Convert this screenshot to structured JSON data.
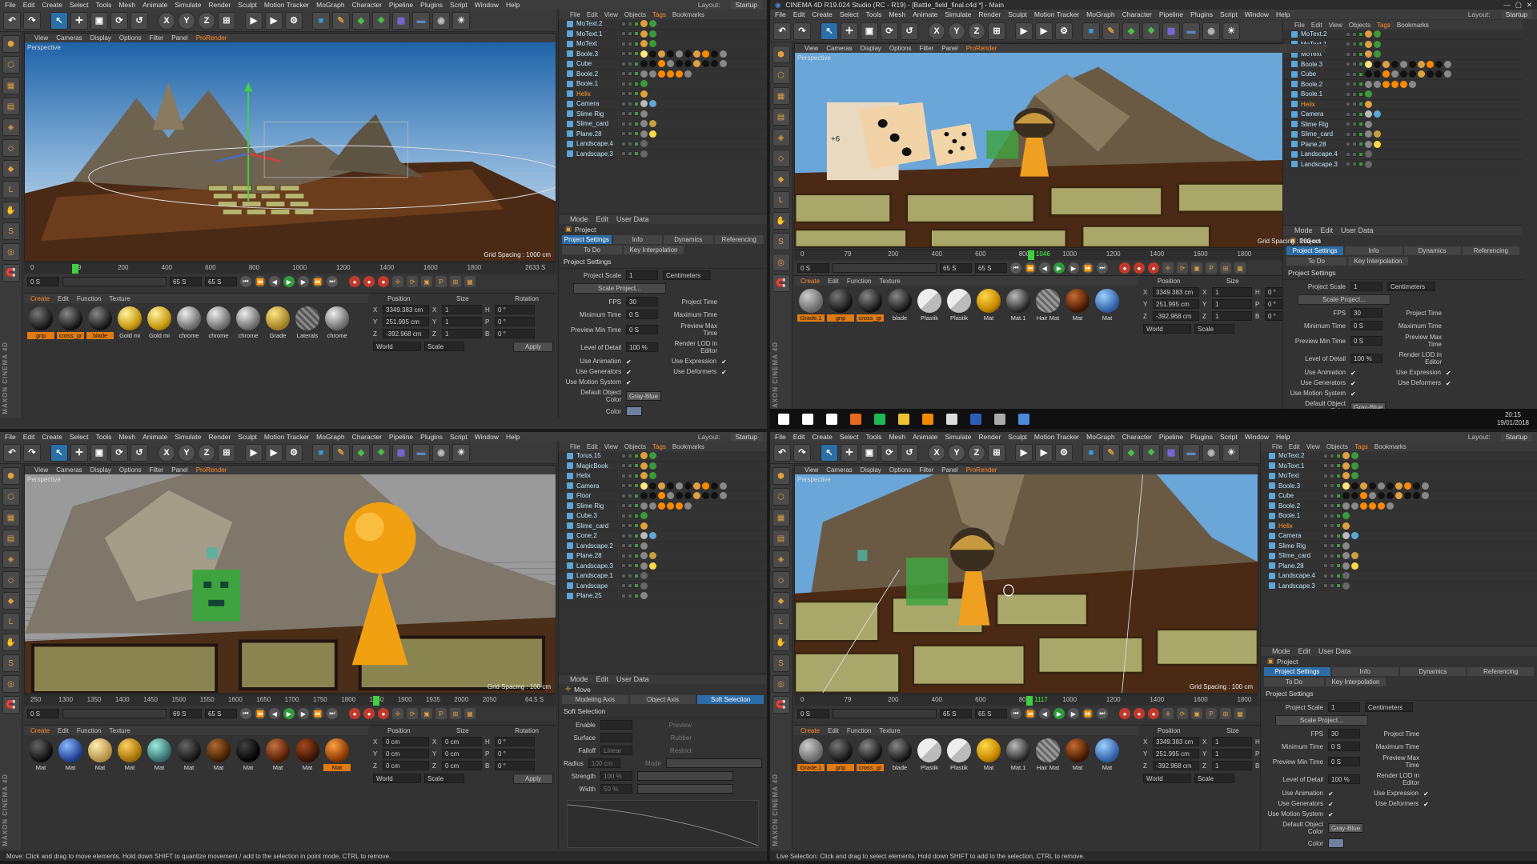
{
  "menu": [
    "File",
    "Edit",
    "Create",
    "Select",
    "Tools",
    "Mesh",
    "Animate",
    "Simulate",
    "Render",
    "Sculpt",
    "Motion Tracker",
    "MoGraph",
    "Character",
    "Pipeline",
    "Plugins",
    "Script",
    "Window",
    "Help"
  ],
  "layout_label": "Layout:",
  "layout_value": "Startup",
  "window_title": "CINEMA 4D R19.024 Studio (RC - R19) - [Battle_field_final.c4d *] - Main",
  "viewport_menu": [
    "View",
    "Cameras",
    "Display",
    "Options",
    "Filter",
    "Panel",
    "ProRender"
  ],
  "viewport_label": "Perspective",
  "grid_q1": "Grid Spacing : 1000 cm",
  "grid_other": "Grid Spacing : 100 cm",
  "obj_menu": [
    "File",
    "Edit",
    "View",
    "Objects",
    "Tags",
    "Bookmarks"
  ],
  "objects_a": [
    "MoText.2",
    "MoText.1",
    "MoText",
    "Boole.3",
    "Cube",
    "Boole.2",
    "Boole.1",
    "Helix",
    "Camera",
    "Slime Rig",
    "Slime_card",
    "Plane.28",
    "Landscape.4",
    "Landscape.3"
  ],
  "objects_b": [
    "Torus.15",
    "MagicBook",
    "Helix",
    "Camera",
    "Floor",
    "Slime Rig",
    "Cube.3",
    "Slime_card",
    "Cone.2",
    "Landscape.2",
    "Plane.28",
    "Landscape.3",
    "Landscape.1",
    "Landscape",
    "Plane.25"
  ],
  "attr_menu": [
    "Mode",
    "Edit",
    "User Data"
  ],
  "attr_title": "Project",
  "attr_tabs": [
    "Project Settings",
    "Info",
    "Dynamics",
    "Referencing"
  ],
  "attr_tabs2": [
    "To Do",
    "Key Interpolation"
  ],
  "section": "Project Settings",
  "project_scale": "Project Scale",
  "scale_val": "1",
  "scale_unit": "Centimeters",
  "scale_btn": "Scale Project...",
  "fps": "FPS",
  "fps_val": "30",
  "project_time": "Project Time",
  "min_time": "Minimum Time",
  "min_val": "0 S",
  "max_time": "Maximum Time",
  "prev_min": "Preview Min Time",
  "prev_max": "Preview Max Time",
  "lod": "Level of Detail",
  "lod_val": "100 %",
  "render_lod": "Render LOD in Editor",
  "use_anim": "Use Animation",
  "use_expr": "Use Expression",
  "use_gen": "Use Generators",
  "use_def": "Use Deformers",
  "use_motion": "Use Motion System",
  "def_color": "Default Object Color",
  "def_color_val": "Gray-Blue",
  "color": "Color",
  "move_title": "Move",
  "move_tabs": [
    "Modeling Axis",
    "Object Axis",
    "Soft Selection"
  ],
  "soft_sel": "Soft Selection",
  "soft_rows": [
    "Enable",
    "Surface",
    "Falloff",
    "Radius",
    "Strength",
    "Width"
  ],
  "soft_vals": [
    "",
    "",
    "Linear",
    "100 cm",
    "100 %",
    "50 %"
  ],
  "soft_right": [
    "Preview",
    "Rubber",
    "Restrict",
    "Mode"
  ],
  "mat_menu": [
    "Create",
    "Edit",
    "Function",
    "Texture"
  ],
  "mats_a": [
    "grip",
    "cross_gr",
    "blade",
    "Gold mi",
    "Gold mi",
    "chrome",
    "chrome",
    "chrome",
    "Grade",
    "Laterals",
    "chrome"
  ],
  "mats_b": [
    "Grade.1",
    "grip",
    "cross_gr",
    "blade",
    "Plastik",
    "Plastik",
    "Mat",
    "Mat.1",
    "Hair Mat",
    "Mat",
    "Mat"
  ],
  "mats_c": [
    "Mat",
    "Mat",
    "Mat",
    "Mat",
    "Mat",
    "Mat",
    "Mat",
    "Mat",
    "Mat",
    "Mat",
    "Mat"
  ],
  "coord_head": [
    "Position",
    "Size",
    "Rotation"
  ],
  "pos": [
    "3349.383 cm",
    "251.995 cm",
    "-392.968 cm"
  ],
  "size": [
    "1",
    "1",
    "1"
  ],
  "rot": [
    "0 °",
    "0 °",
    "0 °"
  ],
  "axes": [
    "X",
    "Y",
    "Z"
  ],
  "rot_axes": [
    "H",
    "P",
    "B"
  ],
  "world": "World",
  "scale_lbl": "Scale",
  "apply": "Apply",
  "tl_ticks_a": [
    "0",
    "79",
    "200",
    "400",
    "600",
    "800",
    "1000",
    "1200",
    "1400",
    "1600",
    "1800"
  ],
  "tl_ticks_c": [
    "250",
    "1300",
    "1350",
    "1400",
    "1450",
    "1500",
    "1550",
    "1600",
    "1650",
    "1700",
    "1750",
    "1800",
    "1850",
    "1900",
    "1935",
    "2000",
    "2050"
  ],
  "tl_frame_a": "2633 S",
  "tl_frame_b": "34.867 S",
  "tl_frame_c": "64.5 S",
  "tl_frame_d": "37.233 S",
  "tr_start": "0 S",
  "tr_end": "65 S",
  "tr_end_c": "69 S",
  "tr_mid_c": "41.567 S",
  "status_a": "Move: Click and drag to move elements. Hold down SHIFT to quantize movement / add to the selection in point mode, CTRL to remove.",
  "status_b": "Live Selection: Click and drag to select elements. Hold down SHIFT to add to the selection, CTRL to remove.",
  "clock_time": "20:15",
  "clock_date": "19/01/2018",
  "maxon": "MAXON CINEMA 4D",
  "dice_text": "+6",
  "tl_cur_b": "1046",
  "tl_cur_d": "1117"
}
